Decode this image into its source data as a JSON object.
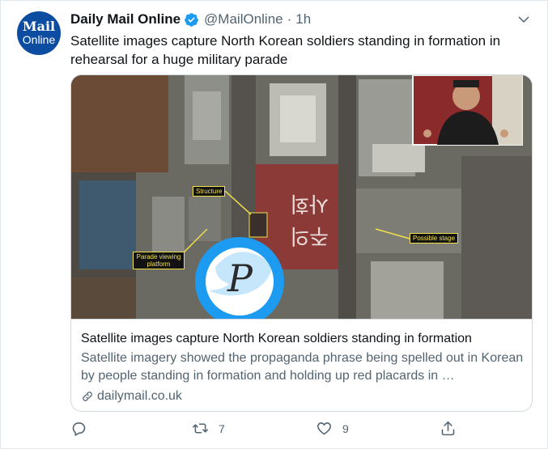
{
  "tweet": {
    "avatar": {
      "line1": "Mail",
      "line2": "Online",
      "color": "#0c4da2"
    },
    "name": "Daily Mail Online",
    "handle": "@MailOnline",
    "separator": "·",
    "time": "1h",
    "text": "Satellite images capture North Korean soldiers standing in formation in rehearsal for a huge military parade"
  },
  "card": {
    "image": {
      "labels": {
        "structure": "Structure",
        "parade_viewing": "Parade viewing platform",
        "possible_stage": "Possible stage"
      },
      "watermark_letter": "P"
    },
    "title": "Satellite images capture North Korean soldiers standing in formation",
    "description": "Satellite imagery showed the propaganda phrase being spelled out in Korean by people standing in formation and holding up red placards in …",
    "domain": "dailymail.co.uk"
  },
  "actions": {
    "reply": {
      "icon": "reply-icon",
      "count": ""
    },
    "retweet": {
      "icon": "retweet-icon",
      "count": "7"
    },
    "like": {
      "icon": "heart-icon",
      "count": "9"
    },
    "share": {
      "icon": "share-icon",
      "count": ""
    }
  },
  "colors": {
    "accent": "#1d9bf0",
    "muted": "#536471",
    "verified": "#1d9bf0"
  }
}
